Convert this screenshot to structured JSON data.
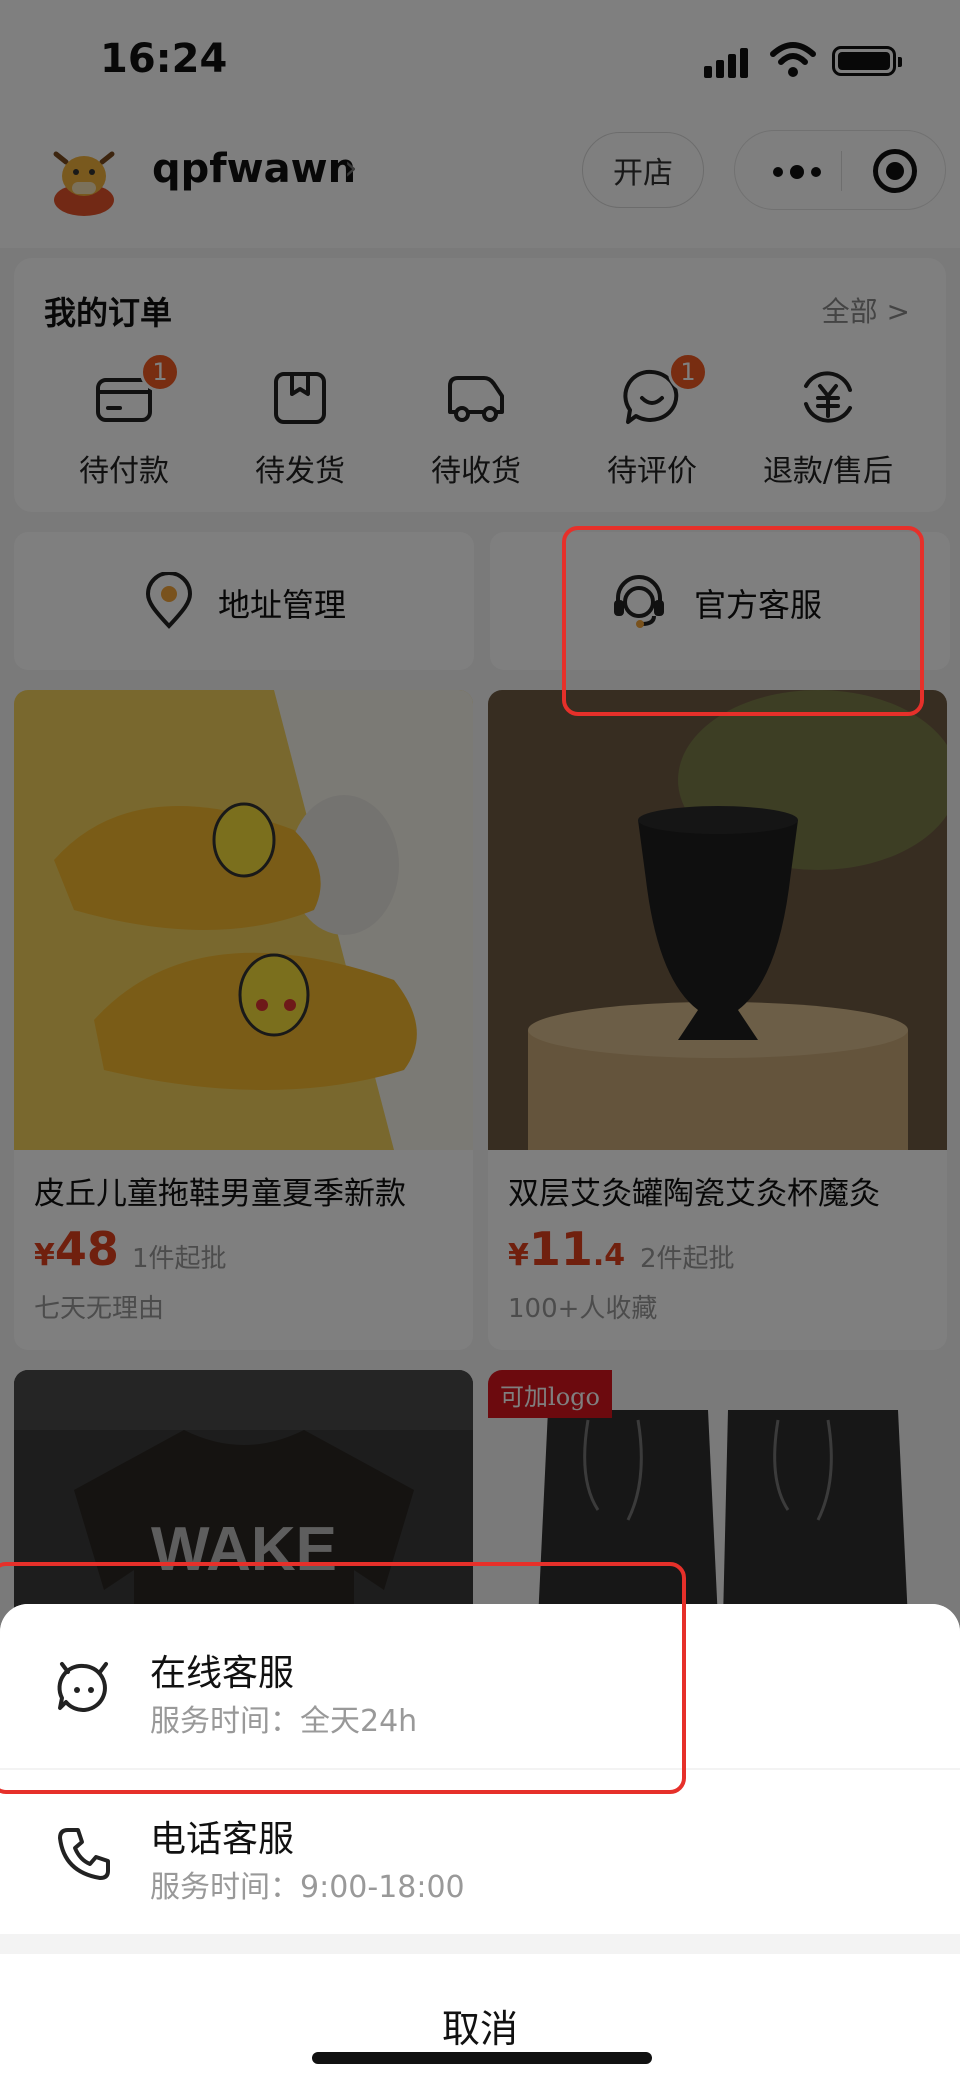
{
  "status_bar": {
    "time": "16:24"
  },
  "header": {
    "username": "qpfwawn",
    "open_shop": "开店"
  },
  "orders": {
    "title": "我的订单",
    "all_link": "全部 >",
    "items": [
      {
        "label": "待付款",
        "badge": "1",
        "icon": "wallet-icon"
      },
      {
        "label": "待发货",
        "badge": "",
        "icon": "package-icon"
      },
      {
        "label": "待收货",
        "badge": "",
        "icon": "truck-icon"
      },
      {
        "label": "待评价",
        "badge": "1",
        "icon": "comment-icon"
      },
      {
        "label": "退款/售后",
        "badge": "",
        "icon": "refund-icon"
      }
    ]
  },
  "services": {
    "address": "地址管理",
    "customer_service": "官方客服"
  },
  "products": [
    {
      "name": "皮丘儿童拖鞋男童夏季新款",
      "currency": "¥",
      "price_int": "48",
      "price_dec": "",
      "moq": "1件起批",
      "tag": "七天无理由"
    },
    {
      "name": "双层艾灸罐陶瓷艾灸杯魔灸",
      "currency": "¥",
      "price_int": "11",
      "price_dec": ".4",
      "moq": "2件起批",
      "tag": "100+人收藏"
    },
    {
      "name": "",
      "currency": "",
      "price_int": "",
      "price_dec": "",
      "moq": "",
      "tag": "",
      "shirt_text": "WAKE"
    },
    {
      "name": "",
      "currency": "",
      "price_int": "",
      "price_dec": "",
      "moq": "",
      "tag": "",
      "logo_tag": "可加logo"
    }
  ],
  "sheet": {
    "online": {
      "title": "在线客服",
      "subtitle": "服务时间：全天24h"
    },
    "phone": {
      "title": "电话客服",
      "subtitle": "服务时间：9:00-18:00"
    },
    "cancel": "取消"
  },
  "colors": {
    "accent": "#e0401d",
    "badge": "#f05a22",
    "highlight": "#e6302a"
  }
}
